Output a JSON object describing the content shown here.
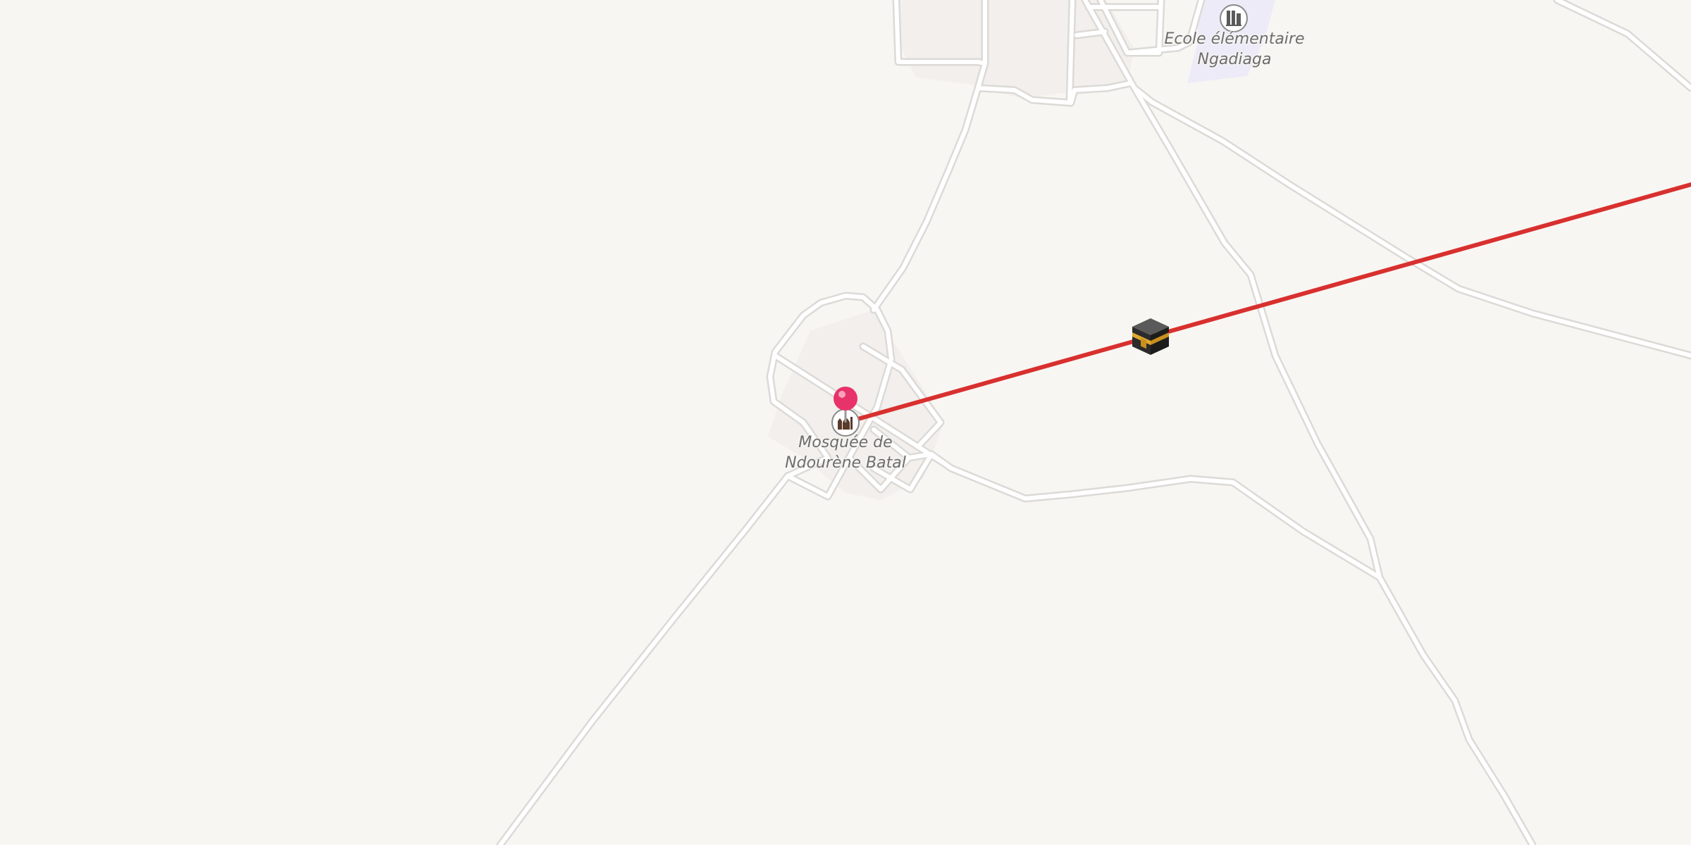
{
  "map": {
    "pois": {
      "school": {
        "name_line1": "Ecole élémentaire",
        "name_line2": "Ngadiaga",
        "icon": "school-icon"
      },
      "mosque": {
        "name_line1": "Mosquée de",
        "name_line2": "Ndourène Batal",
        "icon": "mosque-icon"
      }
    },
    "markers": {
      "location_pin": {
        "icon": "location-pin-icon",
        "color": "#e8336a"
      },
      "kaaba": {
        "icon": "kaaba-icon"
      }
    },
    "qibla_line": {
      "color": "#d8302f"
    },
    "colors": {
      "land": "#f8f6f2",
      "road_fill": "#ffffff",
      "road_casing": "#dcdad6",
      "school_area": "#ecebf7",
      "residential_area": "#f2efec"
    }
  }
}
